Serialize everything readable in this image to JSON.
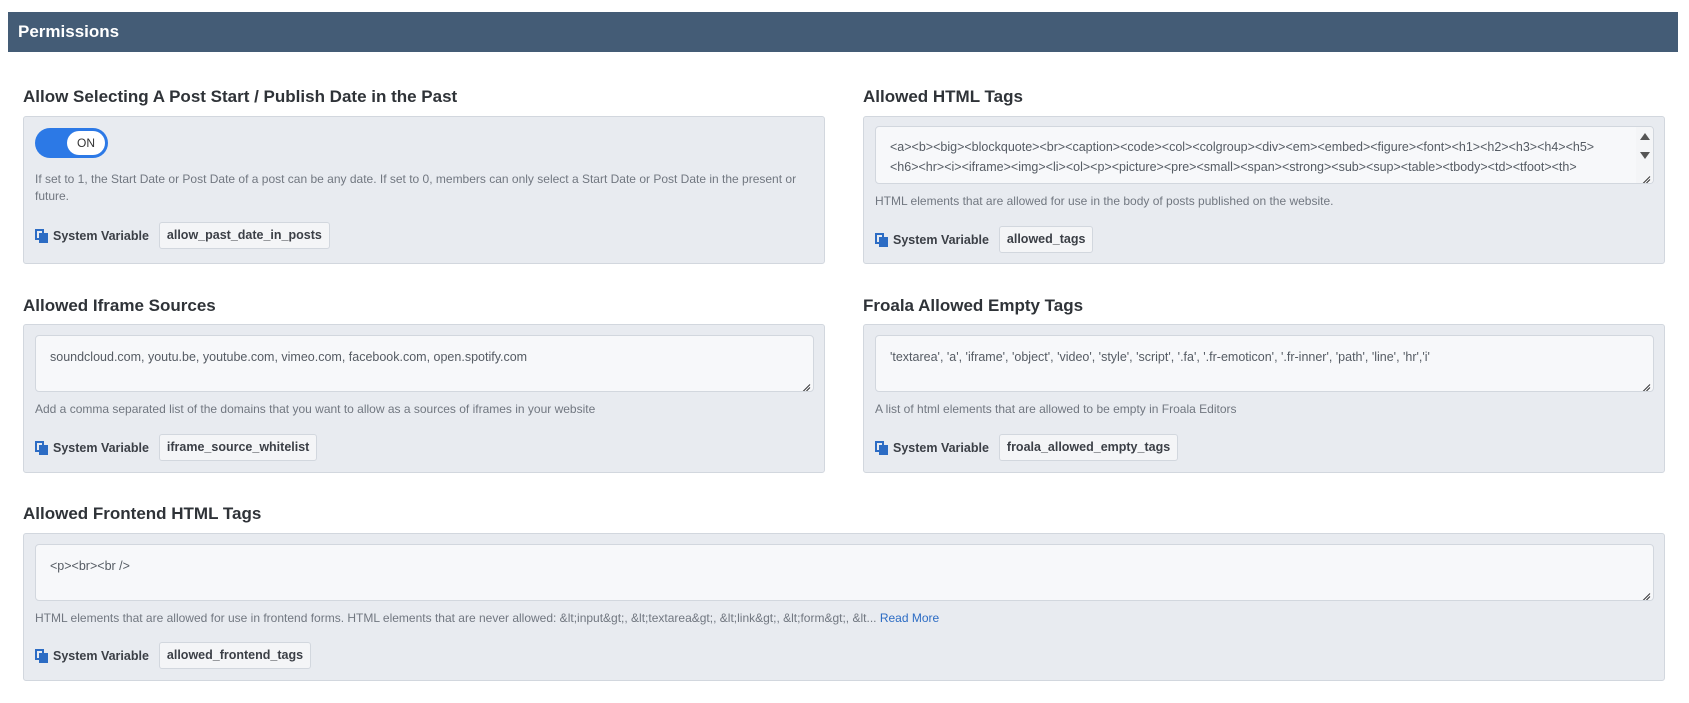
{
  "header": {
    "title": "Permissions"
  },
  "sysvar_label": "System Variable",
  "past_date": {
    "title": "Allow Selecting A Post Start / Publish Date in the Past",
    "toggle_state": "ON",
    "help": "If set to 1, the Start Date or Post Date of a post can be any date.  If set to 0, members can only select a Start Date or Post Date in the present or future.",
    "variable": "allow_past_date_in_posts"
  },
  "allowed_tags": {
    "title": "Allowed HTML Tags",
    "value": "<a><b><big><blockquote><br><caption><code><col><colgroup><div><em><embed><figure><font><h1><h2><h3><h4><h5><h6><hr><i><iframe><img><li><ol><p><picture><pre><small><span><strong><sub><sup><table><tbody><td><tfoot><th><thead><thead><tr><tt><u><ul><video>",
    "help": "HTML elements that are allowed for use in the body of posts published on the website.",
    "variable": "allowed_tags"
  },
  "iframe_sources": {
    "title": "Allowed Iframe Sources",
    "value": "soundcloud.com, youtu.be, youtube.com, vimeo.com, facebook.com, open.spotify.com",
    "help": "Add a comma separated list of the domains that you want to allow as a sources of iframes in your website",
    "variable": "iframe_source_whitelist"
  },
  "froala_empty": {
    "title": "Froala Allowed Empty Tags",
    "value": "'textarea', 'a', 'iframe', 'object', 'video', 'style', 'script', '.fa', '.fr-emoticon', '.fr-inner', 'path', 'line', 'hr','i'",
    "help": "A list of html elements that are allowed to be empty in Froala Editors",
    "variable": "froala_allowed_empty_tags"
  },
  "frontend_tags": {
    "title": "Allowed Frontend HTML Tags",
    "value": "<p><br><br />",
    "help": "HTML elements that are allowed for use in frontend forms. HTML elements that are never allowed: &lt;input&gt;, &lt;textarea&gt;, &lt;link&gt;, &lt;form&gt;, &lt...",
    "read_more": "Read More",
    "variable": "allowed_frontend_tags"
  }
}
